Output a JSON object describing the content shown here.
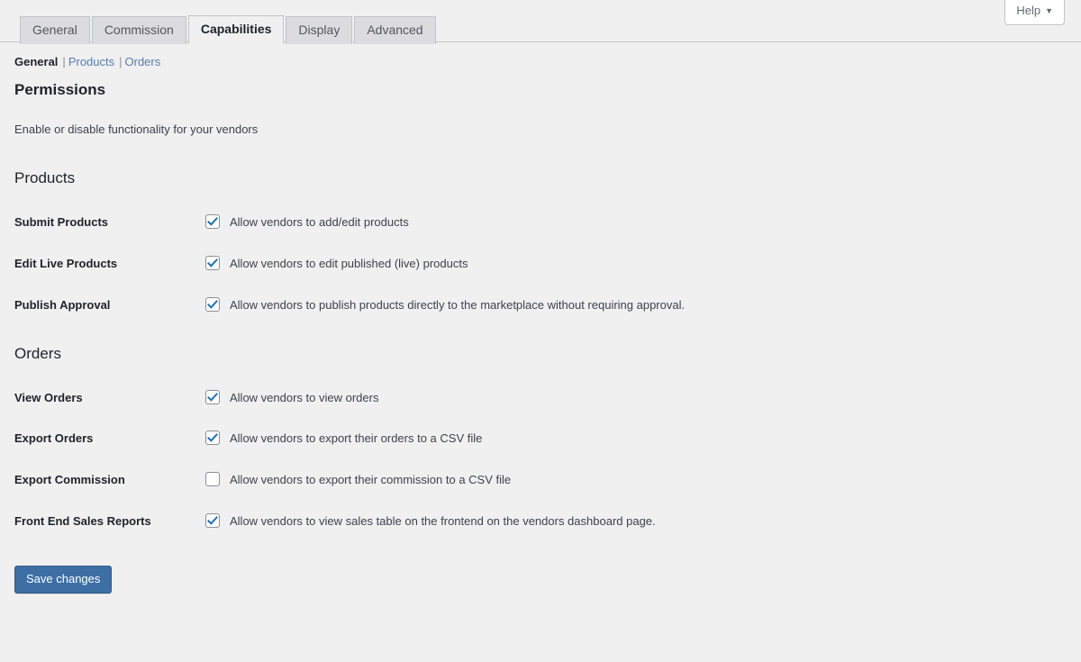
{
  "help": {
    "label": "Help",
    "caret": "chevron-down-icon"
  },
  "tabs": [
    {
      "label": "General",
      "active": false
    },
    {
      "label": "Commission",
      "active": false
    },
    {
      "label": "Capabilities",
      "active": true
    },
    {
      "label": "Display",
      "active": false
    },
    {
      "label": "Advanced",
      "active": false
    }
  ],
  "subnav": {
    "separator": "|",
    "items": [
      {
        "label": "General",
        "active": true
      },
      {
        "label": "Products",
        "active": false
      },
      {
        "label": "Orders",
        "active": false
      }
    ]
  },
  "page": {
    "heading": "Permissions",
    "description": "Enable or disable functionality for your vendors"
  },
  "sections": [
    {
      "heading": "Products",
      "fields": [
        {
          "label": "Submit Products",
          "checkbox_text": "Allow vendors to add/edit products",
          "checked": true
        },
        {
          "label": "Edit Live Products",
          "checkbox_text": "Allow vendors to edit published (live) products",
          "checked": true
        },
        {
          "label": "Publish Approval",
          "checkbox_text": "Allow vendors to publish products directly to the marketplace without requiring approval.",
          "checked": true
        }
      ]
    },
    {
      "heading": "Orders",
      "fields": [
        {
          "label": "View Orders",
          "checkbox_text": "Allow vendors to view orders",
          "checked": true
        },
        {
          "label": "Export Orders",
          "checkbox_text": "Allow vendors to export their orders to a CSV file",
          "checked": true
        },
        {
          "label": "Export Commission",
          "checkbox_text": "Allow vendors to export their commission to a CSV file",
          "checked": false
        },
        {
          "label": "Front End Sales Reports",
          "checkbox_text": "Allow vendors to view sales table on the frontend on the vendors dashboard page.",
          "checked": true
        }
      ]
    }
  ],
  "footer": {
    "save_label": "Save changes"
  },
  "colors": {
    "background": "#f0f0f1",
    "accent_link": "#5a7ca8",
    "checkbox_check": "#2271b1",
    "save_button": "#3d6fa5",
    "tab_inactive": "#dcdcde",
    "tab_active": "#f0f0f1"
  }
}
